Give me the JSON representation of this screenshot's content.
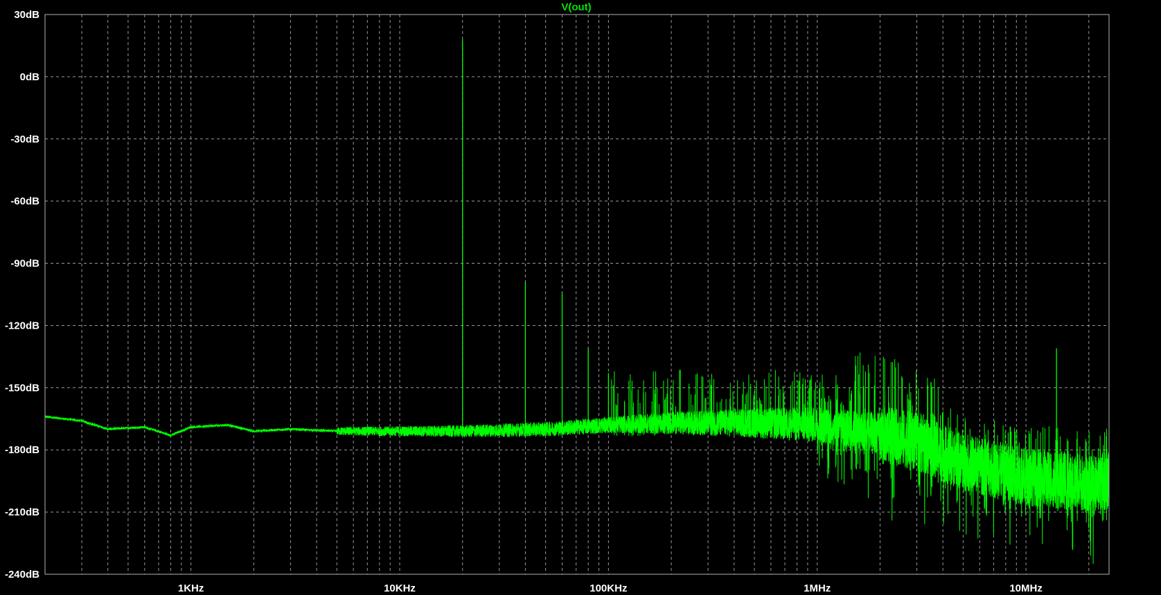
{
  "colors": {
    "background": "#000000",
    "frame": "#b4b4b4",
    "grid": "#9a9a9a",
    "trace": "#00ff00",
    "text": "#ffffff",
    "title": "#00e600"
  },
  "chart_data": {
    "type": "line",
    "title": "V(out)",
    "xlabel": "",
    "ylabel": "",
    "x_scale": "log",
    "x_unit": "Hz",
    "xlim": [
      200,
      25000000
    ],
    "ylim": [
      -240,
      30
    ],
    "grid": true,
    "y_ticks": [
      {
        "value": 30,
        "label": "30dB"
      },
      {
        "value": 0,
        "label": "0dB"
      },
      {
        "value": -30,
        "label": "-30dB"
      },
      {
        "value": -60,
        "label": "-60dB"
      },
      {
        "value": -90,
        "label": "-90dB"
      },
      {
        "value": -120,
        "label": "-120dB"
      },
      {
        "value": -150,
        "label": "-150dB"
      },
      {
        "value": -180,
        "label": "-180dB"
      },
      {
        "value": -210,
        "label": "-210dB"
      },
      {
        "value": -240,
        "label": "-240dB"
      }
    ],
    "x_ticks": [
      {
        "value": 1000,
        "label": "1KHz"
      },
      {
        "value": 10000,
        "label": "10KHz"
      },
      {
        "value": 100000,
        "label": "100KHz"
      },
      {
        "value": 1000000,
        "label": "1MHz"
      },
      {
        "value": 10000000,
        "label": "10MHz"
      }
    ],
    "series": [
      {
        "noise_floor": [
          [
            200,
            -164
          ],
          [
            300,
            -166
          ],
          [
            400,
            -170
          ],
          [
            600,
            -169
          ],
          [
            800,
            -173
          ],
          [
            1000,
            -169
          ],
          [
            1500,
            -168
          ],
          [
            2000,
            -171
          ],
          [
            3000,
            -170
          ],
          [
            5000,
            -171
          ],
          [
            10000,
            -171
          ],
          [
            20000,
            -171
          ],
          [
            50000,
            -170
          ],
          [
            100000,
            -168
          ],
          [
            200000,
            -167
          ],
          [
            500000,
            -167
          ],
          [
            1000000,
            -168
          ],
          [
            2000000,
            -172
          ],
          [
            3000000,
            -176
          ],
          [
            5000000,
            -186
          ],
          [
            10000000,
            -193
          ],
          [
            20000000,
            -196
          ],
          [
            25000000,
            -195
          ]
        ],
        "peaks": [
          {
            "x": 20000,
            "y": 18
          },
          {
            "x": 40000,
            "y": -99
          },
          {
            "x": 60000,
            "y": -104
          },
          {
            "x": 80000,
            "y": -131
          },
          {
            "x": 100000,
            "y": -143
          },
          {
            "x": 14000000,
            "y": -131
          }
        ]
      }
    ]
  }
}
